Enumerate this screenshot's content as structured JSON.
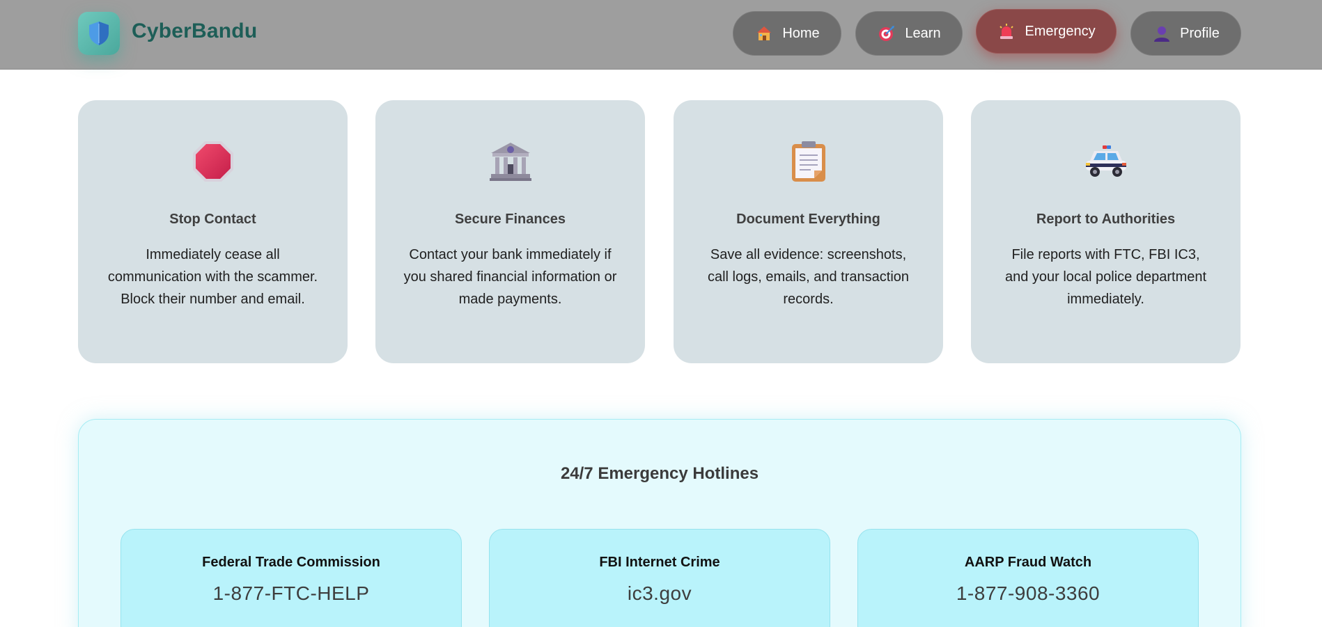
{
  "header": {
    "brand": "CyberBandu",
    "nav": [
      {
        "label": "Home",
        "icon": "house-icon"
      },
      {
        "label": "Learn",
        "icon": "target-icon"
      },
      {
        "label": "Emergency",
        "icon": "siren-icon",
        "active": true
      },
      {
        "label": "Profile",
        "icon": "user-icon"
      }
    ]
  },
  "cards": [
    {
      "icon": "stop-sign-icon",
      "title": "Stop Contact",
      "text": "Immediately cease all communication with the scammer. Block their number and email."
    },
    {
      "icon": "bank-icon",
      "title": "Secure Finances",
      "text": "Contact your bank immediately if you shared financial information or made payments."
    },
    {
      "icon": "clipboard-icon",
      "title": "Document Everything",
      "text": "Save all evidence: screenshots, call logs, emails, and transaction records."
    },
    {
      "icon": "police-car-icon",
      "title": "Report to Authorities",
      "text": "File reports with FTC, FBI IC3, and your local police department immediately."
    }
  ],
  "hotlines": {
    "title": "24/7 Emergency Hotlines",
    "items": [
      {
        "name": "Federal Trade Commission",
        "value": "1-877-FTC-HELP"
      },
      {
        "name": "FBI Internet Crime",
        "value": "ic3.gov"
      },
      {
        "name": "AARP Fraud Watch",
        "value": "1-877-908-3360"
      }
    ]
  },
  "colors": {
    "header_bg": "#9e9e9e",
    "brand": "#1d5e57",
    "emergency_active": "#8a4848",
    "card_bg": "#d6e0e4",
    "hotline_panel_bg": "#e4fafd",
    "hotline_card_bg": "#b9f3fb"
  }
}
